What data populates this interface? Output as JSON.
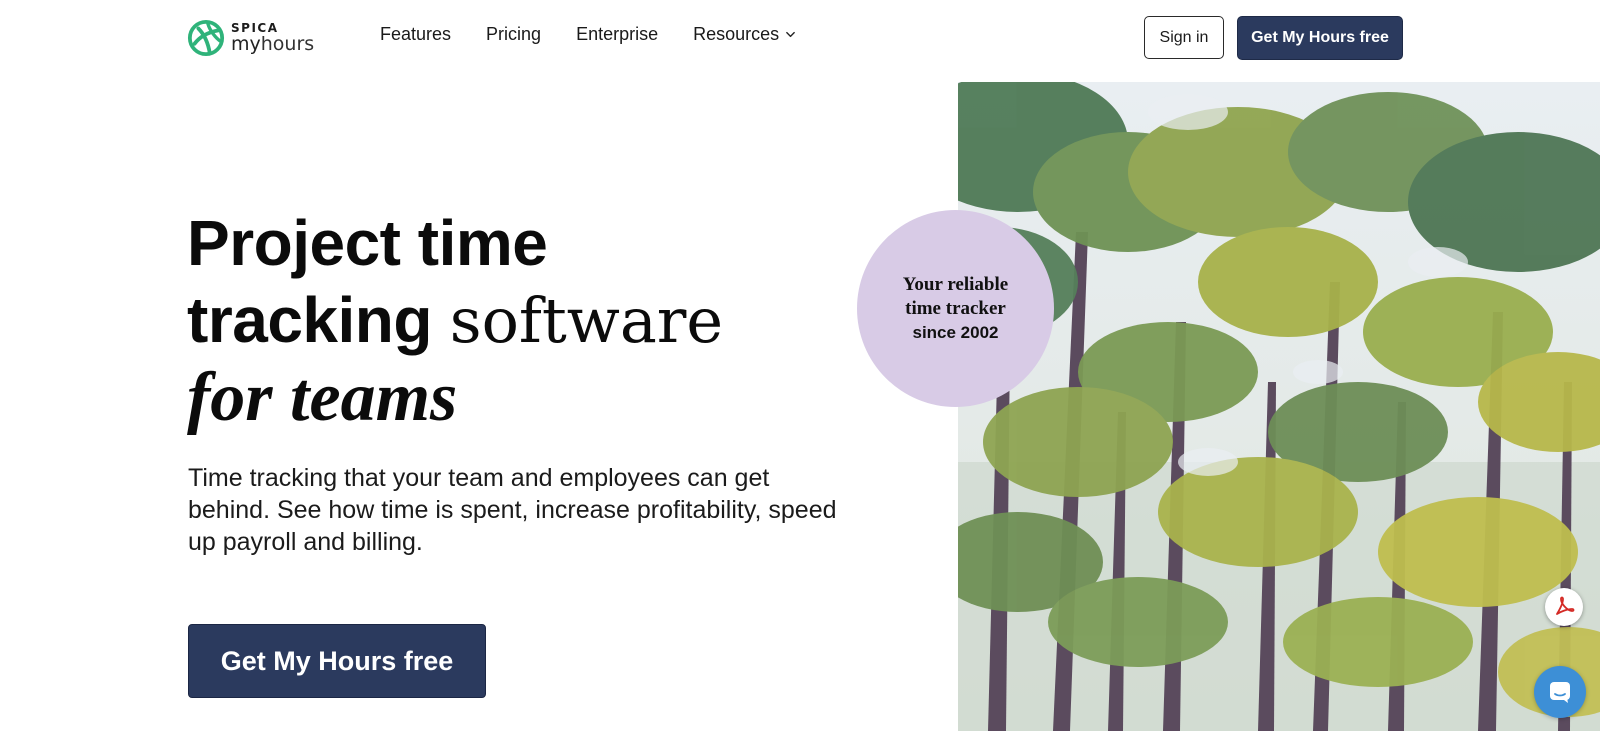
{
  "header": {
    "logo": {
      "brand": "SPICA",
      "product_bold": "my",
      "product_light": "hours"
    },
    "nav": [
      {
        "label": "Features"
      },
      {
        "label": "Pricing"
      },
      {
        "label": "Enterprise"
      },
      {
        "label": "Resources",
        "has_dropdown": true
      }
    ],
    "sign_in_label": "Sign in",
    "cta_label": "Get My Hours free"
  },
  "hero": {
    "title_line1": "Project time",
    "title_line2_bold": "tracking",
    "title_line2_serif": "software",
    "title_line3_italic": "for teams",
    "subtitle": "Time tracking that your team and employees can get behind. See how time is spent, increase profitability, speed up payroll and billing.",
    "cta_label": "Get My Hours free",
    "badge": {
      "line1": "Your reliable",
      "line2": "time tracker",
      "line3": "since 2002"
    }
  },
  "widgets": {
    "pdf_icon": "adobe-pdf-icon",
    "chat_icon": "chat-bubble-icon"
  },
  "colors": {
    "brand_green": "#2fb37a",
    "primary_navy": "#2b3a5e",
    "badge_lavender": "#d8cbe6",
    "chat_blue": "#3d8fd6"
  }
}
